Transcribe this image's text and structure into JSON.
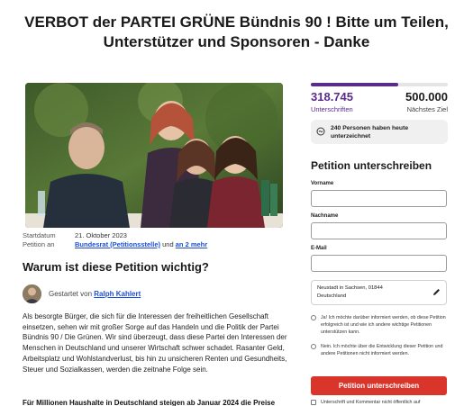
{
  "page": {
    "title_line1": "VERBOT der PARTEI GRÜNE Bündnis 90 ! Bitte um Teilen,",
    "title_line2": "Unterstützer und Sponsoren - Danke"
  },
  "meta": {
    "started_label": "Startdatum",
    "started_value": "21. Oktober 2023",
    "petition_to_label": "Petition an",
    "petition_to_link": "Bundesrat (Petitionsstelle)",
    "petition_to_and": "und",
    "petition_to_more": "an 2 mehr"
  },
  "why": {
    "heading": "Warum ist diese Petition wichtig?"
  },
  "starter": {
    "prefix": "Gestartet von",
    "name": "Ralph Kahlert"
  },
  "body": {
    "paragraph": "Als besorgte Bürger, die sich für die Interessen der freiheitlichen Gesellschaft einsetzen, sehen wir mit großer Sorge auf das Handeln und die Politik der Partei Bündnis 90 / Die Grünen. Wir sind überzeugt, dass diese Partei den Interessen der Menschen in Deutschland und unserer Wirtschaft schwer schadet. Rasanter Geld, Arbeitsplatz und Wohlstandverlust, bis hin zu unsicheren Renten und Gesundheits, Steuer und Sozialkassen, werden die zeitnahe Folge sein.",
    "bold_line": "Für Millionen Haushalte in Deutschland steigen ab Januar 2024 die Preise"
  },
  "progress": {
    "count": "318.745",
    "count_label": "Unterschriften",
    "goal": "500.000",
    "goal_label": "Nächstes Ziel",
    "fraction": 0.6375,
    "accent": "#5b2b8c"
  },
  "today": {
    "icon": "signature-icon",
    "text": "240 Personen haben heute unterzeichnet"
  },
  "form": {
    "heading": "Petition unterschreiben",
    "first_name_label": "Vorname",
    "last_name_label": "Nachname",
    "email_label": "E-Mail",
    "location_line1": "Neustadt in Sachsen, 01844",
    "location_line2": "Deutschland",
    "opt_in_yes": "Ja! Ich möchte darüber informiert werden, ob diese Petition erfolgreich ist und wie ich andere wichtige Petitionen unterstützen kann.",
    "opt_in_no": "Nein. Ich möchte über die Entwicklung dieser Petition und andere Petitionen nicht informiert werden.",
    "submit": "Petition unterschreiben",
    "submit_color": "#d9352b",
    "public_checkbox": "Unterschrift und Kommentar nicht öffentlich auf"
  }
}
